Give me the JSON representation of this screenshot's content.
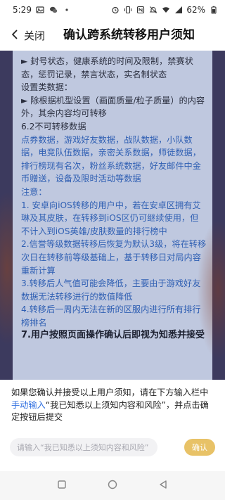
{
  "status_bar": {
    "time": "5:29",
    "battery": "62%",
    "icons": [
      "photo-icon",
      "wechat-icon",
      "dot-icon",
      "alarm-icon",
      "vibrate-icon",
      "nfc-icon",
      "dnd-icon",
      "wifi-icon",
      "signal-icon",
      "battery-icon"
    ]
  },
  "header": {
    "back_label": "关闭",
    "title": "确认跨系统转移用户须知"
  },
  "content": {
    "line1": "► 封号状态，健康系统的时间及限制，禁赛状态，惩罚记录，禁言状态，实名制状态",
    "settings_heading": "设置类数据：",
    "settings_body": "► 除根据机型设置（画面质量/粒子质量）的内容外，其余内容均可转移",
    "no_transfer_heading": "6.2不可转移数据",
    "no_transfer_body": "点券数据，游戏好友数据，战队数据，小队数据，电竞队伍数据，亲密关系数据，师徒数据，排行榜现有名次，粉丝系统数据，好友邮件中金币赠送，设备及限时活动等数据",
    "note_heading": "注意：",
    "note_1": "1. 安卓向iOS转移的用户中，若在安卓区拥有艾琳及其皮肤，在转移到iOS区仍可继续使用，但不计入到iOS英雄/皮肤数量的排行榜中",
    "note_2": "2.信誉等级数据转移后恢复为默认3级，将在转移次日在转移前等级基础上，基于转移日对局内容重新计算",
    "note_3": "3.转移后人气值可能会降低，主要由于游戏好友数据无法转移进行的数值降低",
    "note_4": "4.转移后一周内无法在新的区服内进行所有排行榜排名",
    "section_7": "7.用户按照页面操作确认后即视为知悉并接受"
  },
  "sheet": {
    "instruction_before": "如果您确认并接受以上用户须知，请在下方输入栏中",
    "instruction_link": "手动输入",
    "instruction_quote": "“我已知悉以上须知内容和风险”",
    "instruction_after": "，并点击确定按钮后提交",
    "input_value": "",
    "input_placeholder": "请输入“我已知悉以上须知内容和风险”",
    "confirm_label": "确认"
  },
  "colors": {
    "accent_button": "#e8c267",
    "link_blue": "#2f6fe0",
    "content_blue": "#2f5fb3",
    "frame": "#3c3a5e"
  },
  "nav": {
    "buttons": [
      "recents-icon",
      "home-icon",
      "back-icon"
    ]
  }
}
